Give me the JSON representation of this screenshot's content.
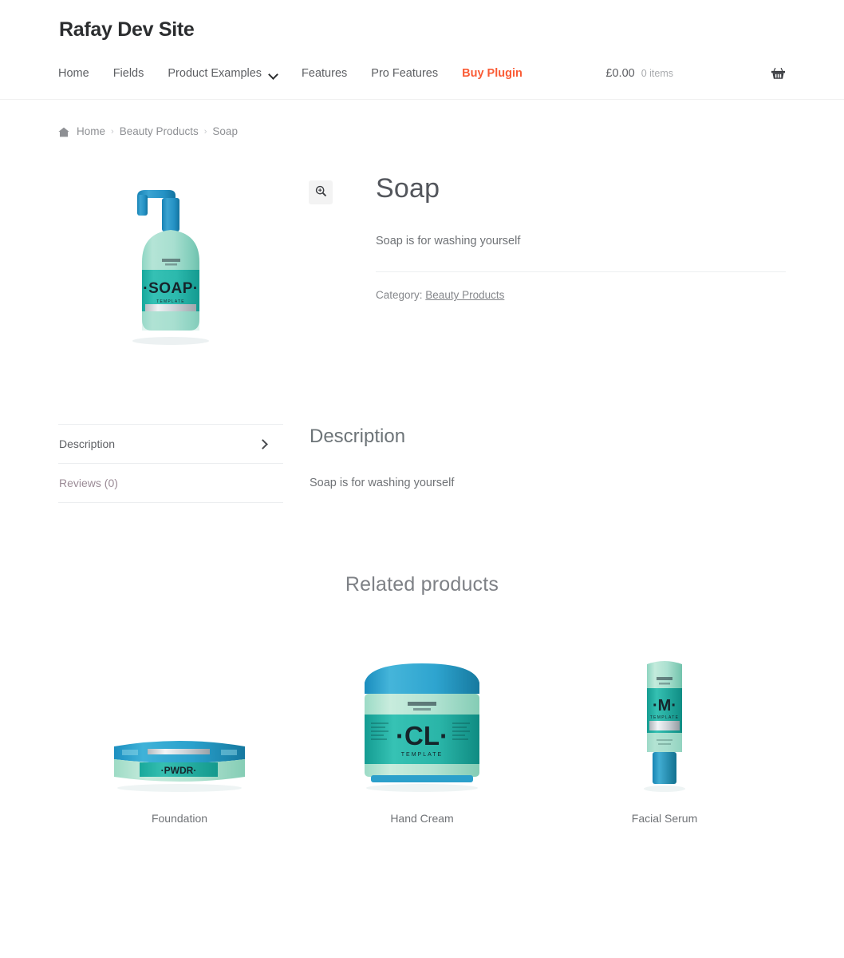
{
  "header": {
    "site_title": "Rafay Dev Site",
    "nav": [
      {
        "label": "Home",
        "accent": false,
        "dropdown": false
      },
      {
        "label": "Fields",
        "accent": false,
        "dropdown": false
      },
      {
        "label": "Product Examples",
        "accent": false,
        "dropdown": true
      },
      {
        "label": "Features",
        "accent": false,
        "dropdown": false
      },
      {
        "label": "Pro Features",
        "accent": false,
        "dropdown": false
      },
      {
        "label": "Buy Plugin",
        "accent": true,
        "dropdown": false
      }
    ],
    "cart": {
      "amount": "£0.00",
      "items": "0 items",
      "icon": "shopping-basket-icon"
    },
    "accent_color": "#fa5b35"
  },
  "breadcrumb": {
    "home_icon": "home-icon",
    "separator": "›",
    "items": [
      {
        "label": "Home",
        "link": true
      },
      {
        "label": "Beauty Products",
        "link": true
      },
      {
        "label": "Soap",
        "link": false
      }
    ]
  },
  "product": {
    "title": "Soap",
    "short_description": "Soap is for washing yourself",
    "image_alt": "Soap dispenser bottle",
    "zoom_button_icon": "zoom-in-icon",
    "meta": {
      "category_label": "Category:",
      "category_value": "Beauty Products"
    }
  },
  "tabs": {
    "items": [
      {
        "label": "Description",
        "active": true,
        "arrow_icon": "chevron-right-icon"
      },
      {
        "label": "Reviews (0)",
        "active": false,
        "arrow_icon": ""
      }
    ],
    "panel": {
      "heading": "Description",
      "body": "Soap is for washing yourself"
    }
  },
  "related": {
    "heading": "Related products",
    "products": [
      {
        "name": "Foundation",
        "image_alt": "Powder compact tin"
      },
      {
        "name": "Hand Cream",
        "image_alt": "Cream jar"
      },
      {
        "name": "Facial Serum",
        "image_alt": "Serum tube"
      }
    ]
  }
}
